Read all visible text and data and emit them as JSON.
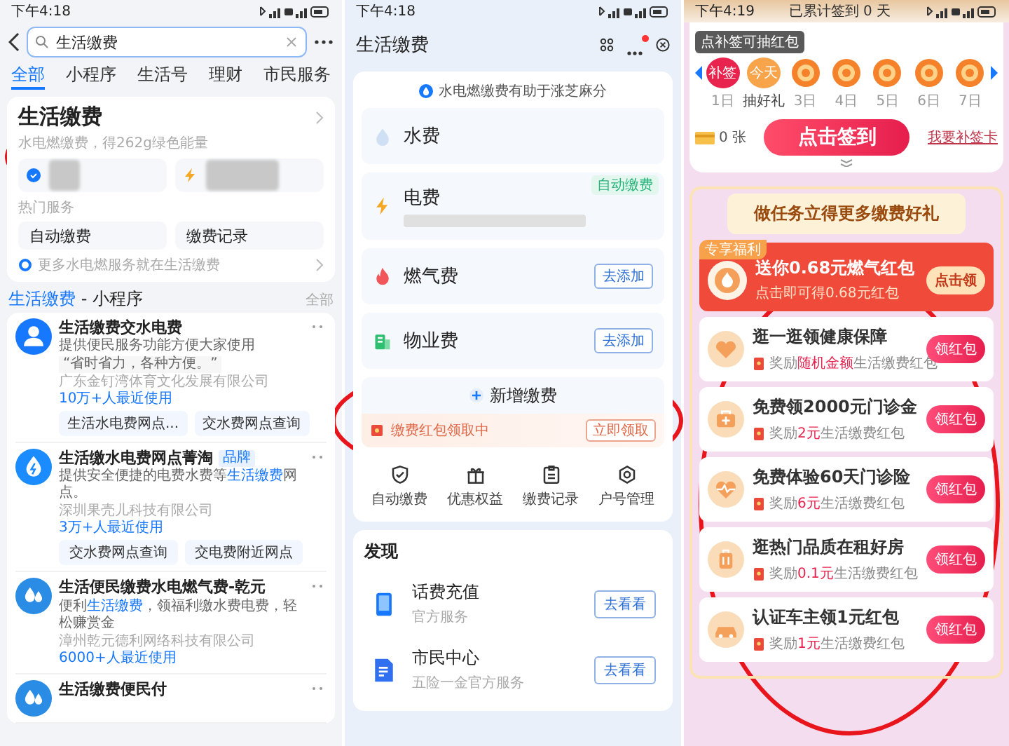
{
  "search_screen": {
    "status_time": "下午4:18",
    "search": {
      "value": "生活缴费"
    },
    "tabs": [
      {
        "label": "全部",
        "selected": true
      },
      {
        "label": "小程序",
        "selected": false
      },
      {
        "label": "生活号",
        "selected": false
      },
      {
        "label": "理财",
        "selected": false
      },
      {
        "label": "市民服务",
        "selected": false
      }
    ],
    "service_card": {
      "title": "生活缴费",
      "subtitle": "水电燃缴费，得262g绿色能量",
      "section_label": "热门服务",
      "services": [
        "自动缴费",
        "缴费记录"
      ],
      "footer": "更多水电燃服务就在生活缴费"
    },
    "section": {
      "title": "**生活缴费** - 小程序",
      "more": "全部"
    },
    "mini_programs": [
      {
        "kind": "person",
        "name": "生活缴费交水电费",
        "description": "提供便民服务功能方便大家使用",
        "quote": "“省时省力，各种方便。”",
        "company": "广东金钉湾体育文化发展有限公司",
        "users": "10万+人最近使用",
        "links": [
          "生活水电费网点...",
          "交水费网点查询"
        ]
      },
      {
        "kind": "bolt",
        "name": "生活缴水电费网点菁淘",
        "badge": "品牌",
        "description": "提供安全便捷的电费水费等**生活缴费**网点。",
        "company": "深圳果壳儿科技有限公司",
        "users": "3万+人最近使用",
        "links": [
          "交水费网点查询",
          "交电费附近网点"
        ]
      },
      {
        "kind": "drops",
        "name": "生活便民缴费水电燃气费-乾元",
        "description": "便利**生活缴费**，领福利缴水费电费，轻松赚赏金",
        "company": "漳州乾元德利网络科技有限公司",
        "users": "6000+人最近使用"
      },
      {
        "kind": "drops",
        "name": "生活缴费便民付"
      }
    ]
  },
  "bill_screen": {
    "status_time": "下午4:18",
    "title": "生活缴费",
    "notice": "水电燃缴费有助于涨芝麻分",
    "bills": [
      {
        "kind": "water",
        "name": "水费"
      },
      {
        "kind": "power",
        "name": "电费",
        "badge": "自动缴费"
      },
      {
        "kind": "gas",
        "name": "燃气费",
        "action": "去添加"
      },
      {
        "kind": "property",
        "name": "物业费",
        "action": "去添加"
      }
    ],
    "add_label": "新增缴费",
    "promo": {
      "text": "缴费红包领取中",
      "action": "立即领取"
    },
    "actions": [
      {
        "kind": "shield",
        "label": "自动缴费"
      },
      {
        "kind": "gift",
        "label": "优惠权益"
      },
      {
        "kind": "clipboard",
        "label": "缴费记录"
      },
      {
        "kind": "gear",
        "label": "户号管理"
      }
    ],
    "discover": {
      "title": "发现",
      "items": [
        {
          "kind": "phone",
          "title": "话费充值",
          "subtitle": "官方服务",
          "action": "去看看"
        },
        {
          "kind": "document",
          "title": "市民中心",
          "subtitle": "五险一金官方服务",
          "action": "去看看"
        }
      ]
    }
  },
  "checkin_screen": {
    "status_time": "下午4:19",
    "streak": "已累计签到 0 天",
    "tooltip": "点补签可抽红包",
    "days": [
      {
        "kind": "makeup",
        "top": "补签",
        "label": "1日"
      },
      {
        "kind": "today",
        "top": "今天",
        "label": "抽好礼"
      },
      {
        "kind": "coin",
        "label": "3日"
      },
      {
        "kind": "coin",
        "label": "4日"
      },
      {
        "kind": "coin",
        "label": "5日"
      },
      {
        "kind": "coin",
        "label": "6日"
      },
      {
        "kind": "coin",
        "label": "7日"
      }
    ],
    "cards_count": "0 张",
    "checkin_button": "点击签到",
    "makeup_link": "我要补签卡",
    "task_title": "做任务立得更多缴费好礼",
    "featured": {
      "badge": "专享福利",
      "title": "送你0.68元燃气红包",
      "subtitle": "点击即可得0.68元红包",
      "action": "点击领"
    },
    "tasks": [
      {
        "kind": "heart",
        "title": "逛一逛领健康保障",
        "reward": "奖励**随机金额**生活缴费红包",
        "action": "领红包"
      },
      {
        "kind": "kit",
        "title": "免费领2000元门诊金",
        "reward": "奖励**2元**生活缴费红包",
        "action": "领红包"
      },
      {
        "kind": "pulse",
        "title": "免费体验60天门诊险",
        "reward": "奖励**6元**生活缴费红包",
        "action": "领红包"
      },
      {
        "kind": "suitcase",
        "title": "逛热门品质在租好房",
        "reward": "奖励**0.1元**生活缴费红包",
        "action": "领红包"
      },
      {
        "kind": "car",
        "title": "认证车主领1元红包",
        "reward": "奖励**1元**生活缴费红包",
        "action": "领红包"
      }
    ]
  }
}
